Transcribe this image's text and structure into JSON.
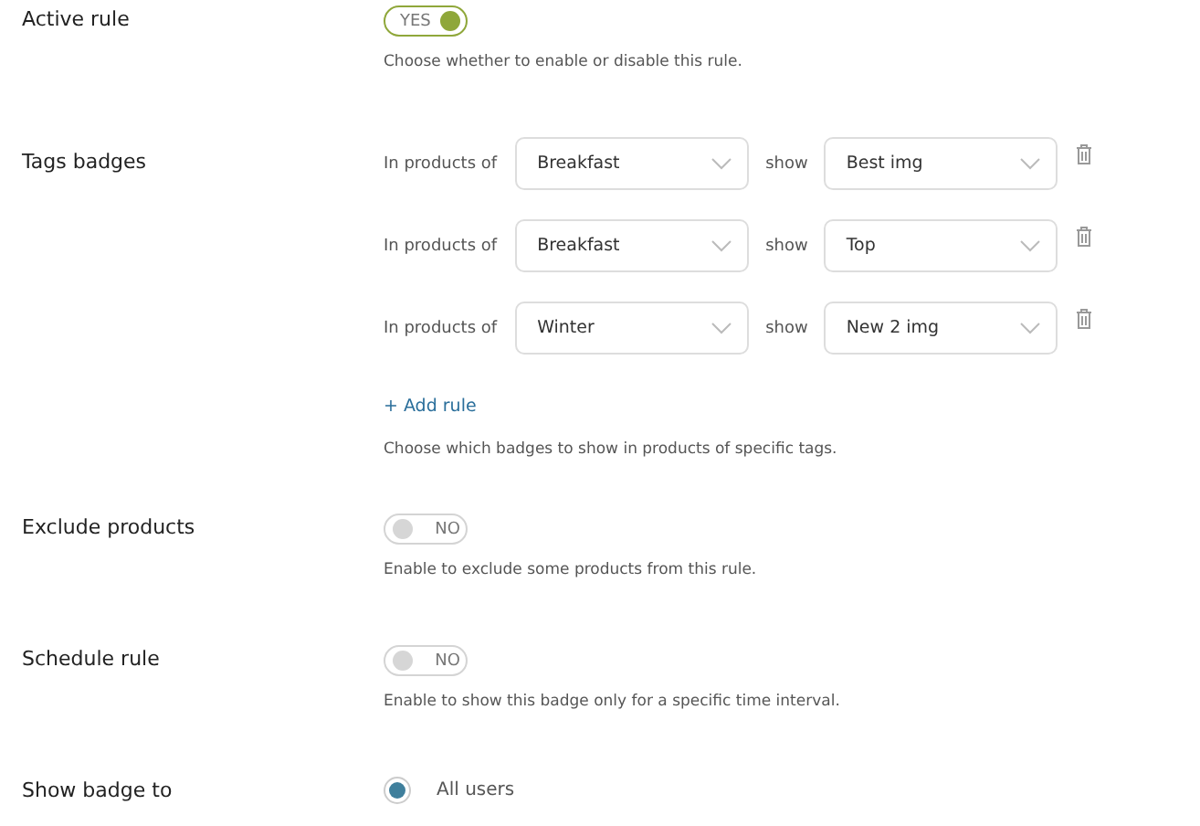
{
  "settings": [
    {
      "kind": "toggle",
      "label": "Active rule",
      "on": true,
      "toggle_text": "YES",
      "description": "Choose whether to enable or disable this rule."
    },
    {
      "kind": "tag_rules",
      "label": "Tags badges",
      "rules": [
        {
          "prefix": "In products of",
          "tag": "Breakfast",
          "joiner": "show",
          "badge": "Best img"
        },
        {
          "prefix": "In products of",
          "tag": "Breakfast",
          "joiner": "show",
          "badge": "Top"
        },
        {
          "prefix": "In products of",
          "tag": "Winter",
          "joiner": "show",
          "badge": "New 2 img"
        }
      ],
      "add_link": "+ Add rule",
      "description": "Choose which badges to show in products of specific tags."
    },
    {
      "kind": "toggle",
      "label": "Exclude products",
      "on": false,
      "toggle_text": "NO",
      "description": "Enable to exclude some products from this rule."
    },
    {
      "kind": "toggle",
      "label": "Schedule rule",
      "on": false,
      "toggle_text": "NO",
      "description": "Enable to show this badge only for a specific time interval."
    },
    {
      "kind": "radio",
      "label": "Show badge to",
      "options": [
        {
          "label": "All users",
          "selected": true
        }
      ]
    }
  ]
}
